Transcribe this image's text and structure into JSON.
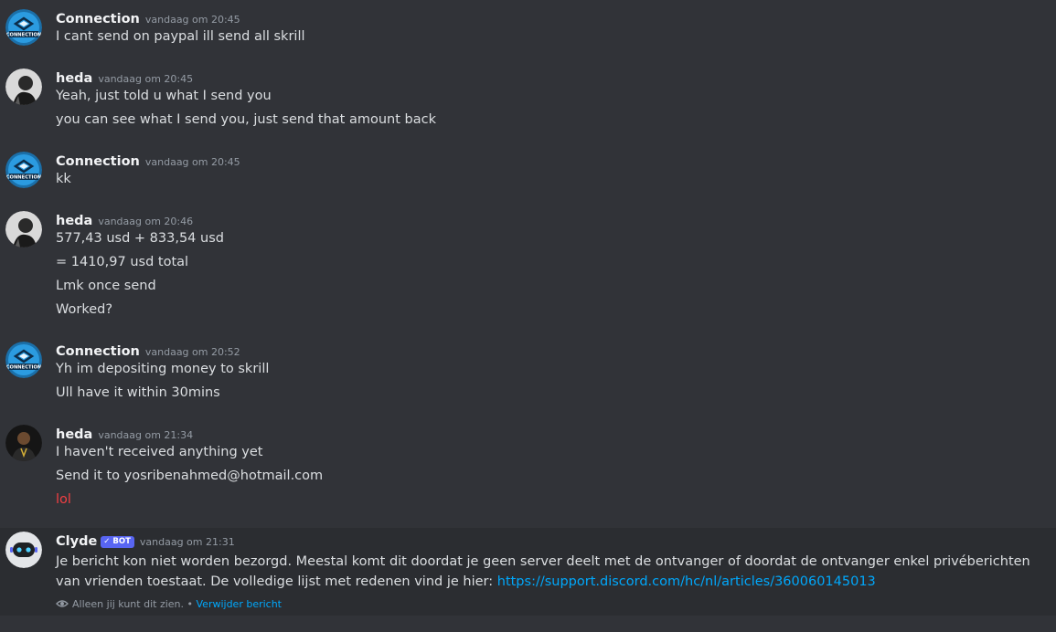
{
  "messages": [
    {
      "username": "Connection",
      "timestamp": "vandaag om 20:45",
      "avatar": "connection-logo",
      "lines": [
        "I cant send on paypal ill send all skrill"
      ]
    },
    {
      "username": "heda",
      "timestamp": "vandaag om 20:45",
      "avatar": "heda-photo",
      "lines": [
        "Yeah, just told u what I send you",
        "you can see what I send you, just send that amount back"
      ]
    },
    {
      "username": "Connection",
      "timestamp": "vandaag om 20:45",
      "avatar": "connection-logo",
      "lines": [
        "kk"
      ]
    },
    {
      "username": "heda",
      "timestamp": "vandaag om 20:46",
      "avatar": "heda-photo",
      "lines": [
        "577,43 usd + 833,54 usd",
        "= 1410,97 usd total",
        "Lmk once send",
        "Worked?"
      ]
    },
    {
      "username": "Connection",
      "timestamp": "vandaag om 20:52",
      "avatar": "connection-logo",
      "lines": [
        "Yh im depositing money to skrill",
        "Ull have it within 30mins"
      ]
    },
    {
      "username": "heda",
      "timestamp": "vandaag om 21:34",
      "avatar": "heda-photo",
      "lines": [
        "I haven't received anything yet",
        "Send it to yosribenahmed@hotmail.com",
        "lol"
      ]
    }
  ],
  "avatar_text": {
    "connection": "CONNECTION"
  },
  "clyde": {
    "username": "Clyde",
    "bot_tag": "BOT",
    "timestamp": "vandaag om 21:31",
    "text": "Je bericht kon niet worden bezorgd. Meestal komt dit doordat je geen server deelt met de ontvanger of doordat de ontvanger enkel privéberichten van vrienden toestaat. De volledige lijst met redenen vind je hier: ",
    "link": "https://support.discord.com/hc/nl/articles/360060145013",
    "notice": "Alleen jij kunt dit zien.",
    "notice_sep": " • ",
    "delete_label": "Verwijder bericht"
  },
  "colors": {
    "background": "#313338",
    "clyde_background": "#2b2d31",
    "username": "#f2f3f5",
    "text": "#dbdee1",
    "muted": "#949ba4",
    "link": "#00a8fc",
    "error_red": "#f23f43",
    "bot_tag": "#5865f2"
  }
}
